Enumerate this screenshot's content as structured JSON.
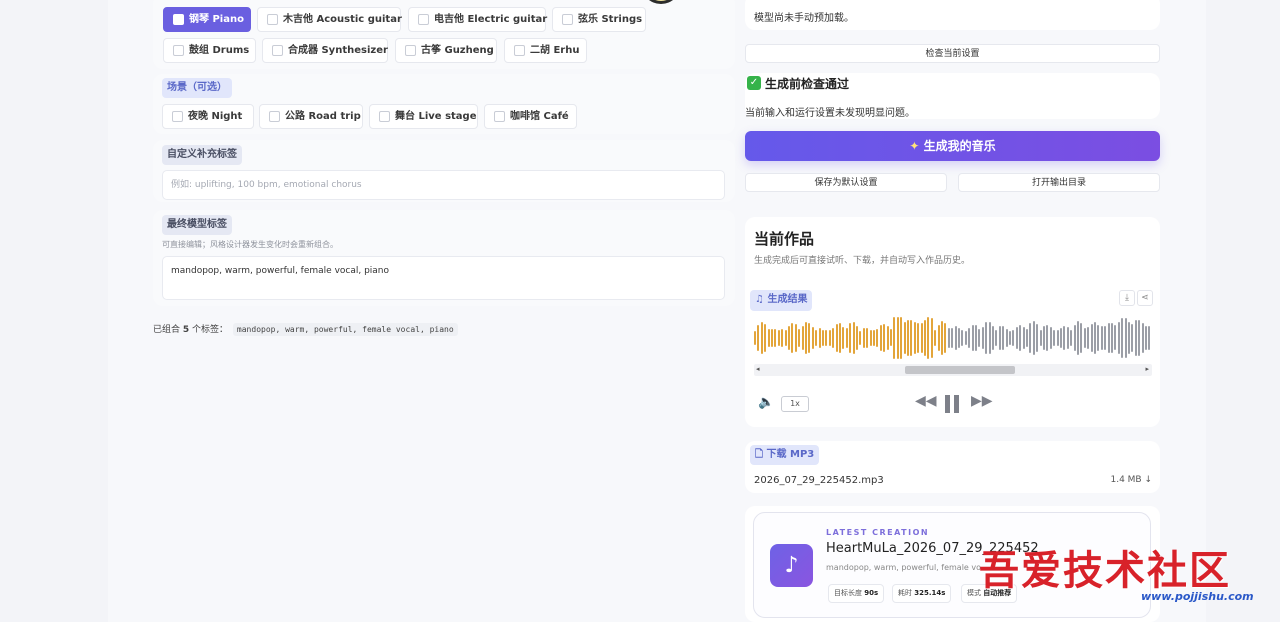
{
  "instruments": [
    {
      "label": "钢琴 Piano",
      "selected": true
    },
    {
      "label": "木吉他 Acoustic guitar",
      "selected": false
    },
    {
      "label": "电吉他 Electric guitar",
      "selected": false
    },
    {
      "label": "弦乐 Strings",
      "selected": false
    },
    {
      "label": "鼓组 Drums",
      "selected": false
    },
    {
      "label": "合成器 Synthesizer",
      "selected": false
    },
    {
      "label": "古筝 Guzheng",
      "selected": false
    },
    {
      "label": "二胡 Erhu",
      "selected": false
    }
  ],
  "scene": {
    "title": "场景（可选）",
    "options": [
      {
        "label": "夜晚 Night"
      },
      {
        "label": "公路 Road trip"
      },
      {
        "label": "舞台 Live stage"
      },
      {
        "label": "咖啡馆 Café"
      }
    ]
  },
  "custom_tags": {
    "title": "自定义补充标签",
    "placeholder": "例如: uplifting, 100 bpm, emotional chorus"
  },
  "final_tags": {
    "title": "最终模型标签",
    "hint": "可直接编辑；风格设计器发生变化时会重新组合。",
    "value": "mandopop, warm, powerful, female vocal, piano"
  },
  "summary": {
    "prefix": "已组合",
    "count": "5",
    "suffix": "个标签：",
    "tags": "mandopop, warm, powerful, female vocal, piano"
  },
  "right": {
    "model_status": "模型尚未手动预加载。",
    "check_button": "检查当前设置",
    "check_title": "生成前检查通过",
    "check_desc": "当前输入和运行设置未发现明显问题。",
    "generate_button": "生成我的音乐",
    "save_default": "保存为默认设置",
    "open_output": "打开输出目录"
  },
  "current_work": {
    "title": "当前作品",
    "subtitle": "生成完成后可直接试听、下载，并自动写入作品历史。",
    "result_label": "生成结果",
    "speed": "1x",
    "played_fraction": 0.48
  },
  "download": {
    "label": "下载 MP3",
    "filename": "2026_07_29_225452.mp3",
    "size": "1.4 MB ↓"
  },
  "latest": {
    "eyebrow": "LATEST CREATION",
    "title": "HeartMuLa_2026_07_29_225452",
    "tags": "mandopop, warm, powerful, female vo",
    "stats": [
      {
        "label": "目标长度",
        "value": "90s"
      },
      {
        "label": "耗时",
        "value": "325.14s"
      },
      {
        "label": "模式",
        "value": "自动推荐"
      }
    ]
  },
  "watermark": {
    "text": "吾爱技术社区",
    "url": "www.pojjishu.com"
  },
  "colors": {
    "accent": "#6a5fe0",
    "wave_played": "#e3a53a",
    "wave_unplayed": "#9b9ea6"
  }
}
